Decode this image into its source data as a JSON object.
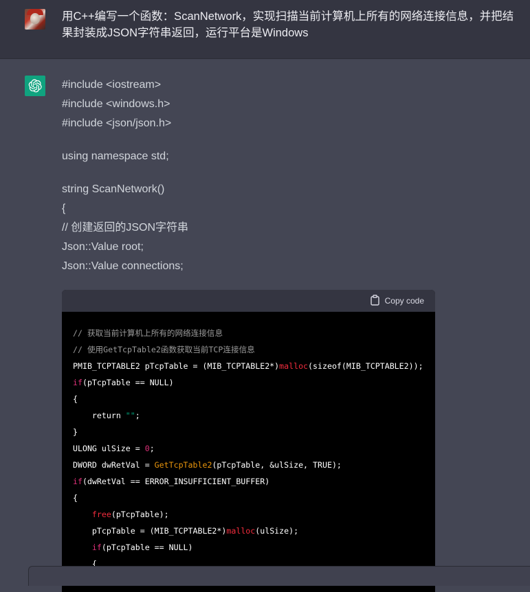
{
  "user": {
    "avatar_icon": "user-avatar",
    "message": "用C++编写一个函数：ScanNetwork，实现扫描当前计算机上所有的网络连接信息，并把结果封装成JSON字符串返回，运行平台是Windows"
  },
  "assistant": {
    "avatar_icon": "openai-logo-icon",
    "paragraphs": [
      [
        "#include <iostream>",
        "#include <windows.h>",
        "#include <json/json.h>"
      ],
      [
        "using namespace std;"
      ],
      [
        "string ScanNetwork()",
        "{",
        "// 创建返回的JSON字符串",
        "Json::Value root;",
        "Json::Value connections;"
      ]
    ],
    "code_block": {
      "copy_label": "Copy code",
      "copy_icon": "clipboard-icon",
      "lines": [
        "// 获取当前计算机上所有的网络连接信息",
        "// 使用GetTcpTable2函数获取当前TCP连接信息",
        "PMIB_TCPTABLE2 pTcpTable = (MIB_TCPTABLE2*)malloc(sizeof(MIB_TCPTABLE2));",
        "if(pTcpTable == NULL)",
        "{",
        "    return \"\";",
        "}",
        "ULONG ulSize = 0;",
        "DWORD dwRetVal = GetTcpTable2(pTcpTable, &ulSize, TRUE);",
        "if(dwRetVal == ERROR_INSUFFICIENT_BUFFER)",
        "{",
        "    free(pTcpTable);",
        "    pTcpTable = (MIB_TCPTABLE2*)malloc(ulSize);",
        "    if(pTcpTable == NULL)",
        "    {"
      ]
    }
  },
  "colors": {
    "page_bg": "#444654",
    "user_row_bg": "#343541",
    "assistant_avatar_bg": "#10a37f",
    "code_bg": "#000000",
    "code_header_bg": "#343541"
  }
}
